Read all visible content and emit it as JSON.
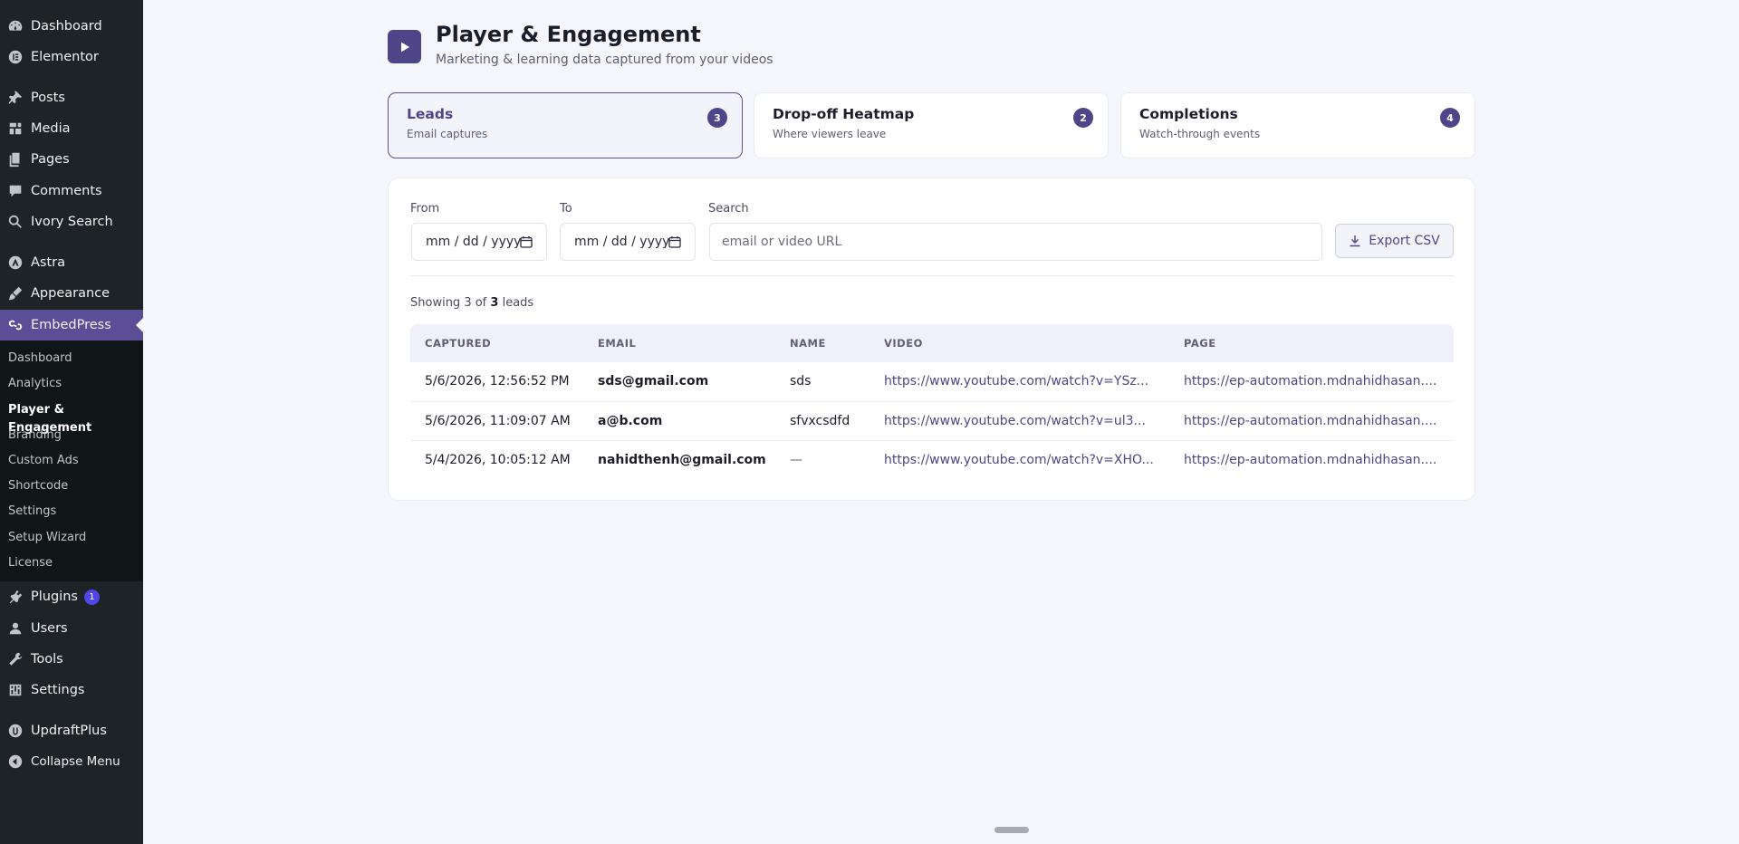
{
  "sidebar": {
    "items": [
      {
        "label": "Dashboard",
        "icon": "dashboard-icon"
      },
      {
        "label": "Elementor",
        "icon": "elementor-icon"
      },
      {
        "label": "Posts",
        "icon": "pin-icon"
      },
      {
        "label": "Media",
        "icon": "media-icon"
      },
      {
        "label": "Pages",
        "icon": "pages-icon"
      },
      {
        "label": "Comments",
        "icon": "comments-icon"
      },
      {
        "label": "Ivory Search",
        "icon": "search-icon"
      },
      {
        "label": "Astra",
        "icon": "astra-icon"
      },
      {
        "label": "Appearance",
        "icon": "brush-icon"
      },
      {
        "label": "EmbedPress",
        "icon": "embedpress-icon"
      },
      {
        "label": "Plugins",
        "icon": "plugins-icon",
        "badge": "1"
      },
      {
        "label": "Users",
        "icon": "users-icon"
      },
      {
        "label": "Tools",
        "icon": "wrench-icon"
      },
      {
        "label": "Settings",
        "icon": "settings-icon"
      },
      {
        "label": "UpdraftPlus",
        "icon": "updraft-icon"
      },
      {
        "label": "Collapse Menu",
        "icon": "collapse-icon"
      }
    ],
    "submenu": [
      "Dashboard",
      "Analytics",
      "Player & Engagement",
      "Branding",
      "Custom Ads",
      "Shortcode",
      "Settings",
      "Setup Wizard",
      "License"
    ]
  },
  "header": {
    "title": "Player & Engagement",
    "subtitle": "Marketing & learning data captured from your videos"
  },
  "tabs": [
    {
      "title": "Leads",
      "subtitle": "Email captures",
      "count": "3"
    },
    {
      "title": "Drop-off Heatmap",
      "subtitle": "Where viewers leave",
      "count": "2"
    },
    {
      "title": "Completions",
      "subtitle": "Watch-through events",
      "count": "4"
    }
  ],
  "filters": {
    "from_label": "From",
    "to_label": "To",
    "search_label": "Search",
    "from_value": "mm / dd / yyyy",
    "to_value": "mm / dd / yyyy",
    "search_placeholder": "email or video URL",
    "export_label": "Export CSV"
  },
  "summary": {
    "prefix": "Showing 3 of",
    "count": "3",
    "suffix": "leads"
  },
  "table": {
    "columns": [
      "CAPTURED",
      "EMAIL",
      "NAME",
      "VIDEO",
      "PAGE"
    ],
    "rows": [
      [
        "5/6/2026, 12:56:52 PM",
        "sds@gmail.com",
        "sds",
        "https://www.youtube.com/watch?v=YSz...",
        "https://ep-automation.mdnahidhasan...."
      ],
      [
        "5/6/2026, 11:09:07 AM",
        "a@b.com",
        "sfvxcsdfd",
        "https://www.youtube.com/watch?v=ul3...",
        "https://ep-automation.mdnahidhasan...."
      ],
      [
        "5/4/2026, 10:05:12 AM",
        "nahidthenh@gmail.com",
        "—",
        "https://www.youtube.com/watch?v=XHO...",
        "https://ep-automation.mdnahidhasan...."
      ]
    ]
  },
  "colors": {
    "accent": "#4f4588",
    "sidebar_bg": "#1d2327",
    "sidebar_active": "#5b4e96",
    "page_bg": "#f5f5fc"
  }
}
